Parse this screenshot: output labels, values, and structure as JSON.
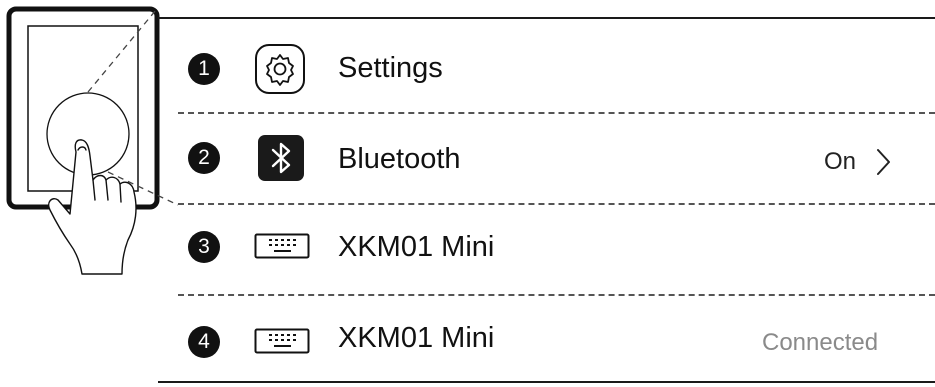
{
  "steps": [
    {
      "number": "1",
      "icon": "gear-icon",
      "label": "Settings",
      "status": ""
    },
    {
      "number": "2",
      "icon": "bluetooth-icon",
      "label": "Bluetooth",
      "status": "On"
    },
    {
      "number": "3",
      "icon": "keyboard-icon",
      "label": "XKM01 Mini",
      "status": ""
    },
    {
      "number": "4",
      "icon": "keyboard-icon",
      "label": "XKM01 Mini",
      "status": "Connected"
    }
  ],
  "colors": {
    "text": "#111111",
    "status_muted": "#8a8a8a",
    "divider": "#555555"
  }
}
